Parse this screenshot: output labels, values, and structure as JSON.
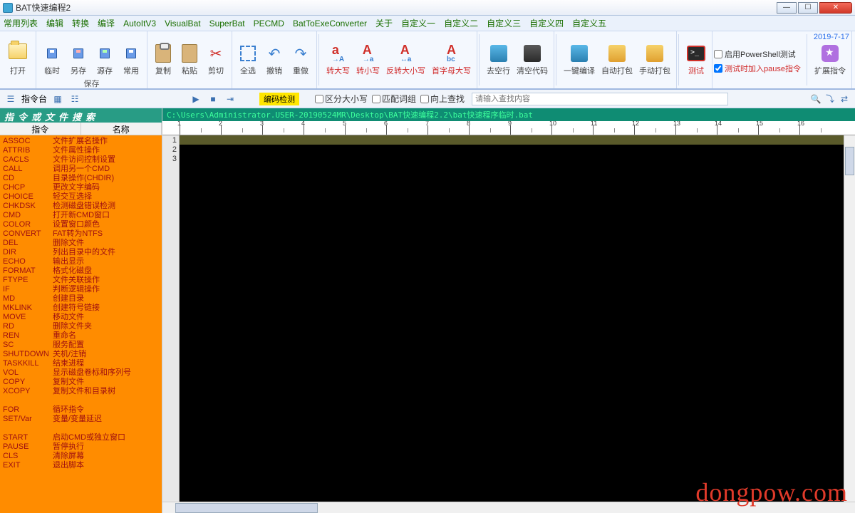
{
  "window": {
    "title": "BAT快速编程2",
    "date": "2019-7-17"
  },
  "menu": [
    "常用列表",
    "编辑",
    "转换",
    "编译",
    "AutoItV3",
    "VisualBat",
    "SuperBat",
    "PECMD",
    "BatToExeConverter",
    "关于",
    "自定义一",
    "自定义二",
    "自定义三",
    "自定义四",
    "自定义五"
  ],
  "ribbon": {
    "open": "打开",
    "save_group_caption": "保存",
    "save_btns": [
      "临时",
      "另存",
      "源存",
      "常用"
    ],
    "copy": "复制",
    "paste": "粘贴",
    "cut": "剪切",
    "selall": "全选",
    "undo": "撤销",
    "redo": "重做",
    "to_upper": "转大写",
    "to_lower": "转小写",
    "flip_case": "反转大小写",
    "first_upper": "首字母大写",
    "trim_blank": "去空行",
    "clear_code": "清空代码",
    "compile": "一键编译",
    "autopack": "自动打包",
    "manualpack": "手动打包",
    "test": "测试",
    "opt_powershell": "启用PowerShell测试",
    "opt_pause": "测试时加入pause指令",
    "ext_cmd": "扩展指令"
  },
  "toolbar2": {
    "panel_label": "指令台",
    "encode_check": "编码检测",
    "chk_case": "区分大小写",
    "chk_word": "匹配词组",
    "chk_up": "向上查找",
    "search_ph": "请输入查找内容"
  },
  "leftpane": {
    "header": "指令或文件搜索",
    "col1": "指令",
    "col2": "名称"
  },
  "commands": [
    {
      "c": "ASSOC",
      "n": "文件扩展名操作"
    },
    {
      "c": "ATTRIB",
      "n": "文件属性操作"
    },
    {
      "c": "CACLS",
      "n": "文件访问控制设置"
    },
    {
      "c": "CALL",
      "n": "调用另一个CMD"
    },
    {
      "c": "CD",
      "n": "目录操作(CHDIR)"
    },
    {
      "c": "CHCP",
      "n": "更改文字编码"
    },
    {
      "c": "CHOICE",
      "n": "轻交互选择"
    },
    {
      "c": "CHKDSK",
      "n": "检测磁盘错误检测"
    },
    {
      "c": "CMD",
      "n": "打开新CMD窗口"
    },
    {
      "c": "COLOR",
      "n": "设置窗口颜色"
    },
    {
      "c": "CONVERT",
      "n": "FAT转为NTFS"
    },
    {
      "c": "DEL",
      "n": "删除文件"
    },
    {
      "c": "DIR",
      "n": "列出目录中的文件"
    },
    {
      "c": "ECHO",
      "n": "输出显示"
    },
    {
      "c": "FORMAT",
      "n": "格式化磁盘"
    },
    {
      "c": "FTYPE",
      "n": "文件关联操作"
    },
    {
      "c": "IF",
      "n": "判断逻辑操作"
    },
    {
      "c": "MD",
      "n": "创建目录"
    },
    {
      "c": "MKLINK",
      "n": "创建符号链接"
    },
    {
      "c": "MOVE",
      "n": "移动文件"
    },
    {
      "c": "RD",
      "n": "删除文件夹"
    },
    {
      "c": "REN",
      "n": "重命名"
    },
    {
      "c": "SC",
      "n": "服务配置"
    },
    {
      "c": "SHUTDOWN",
      "n": "关机/注销"
    },
    {
      "c": "TASKKILL",
      "n": "结束进程"
    },
    {
      "c": "VOL",
      "n": "显示磁盘卷标和序列号"
    },
    {
      "c": "COPY",
      "n": "复制文件"
    },
    {
      "c": "XCOPY",
      "n": "复制文件和目录树"
    }
  ],
  "commands2": [
    {
      "c": "FOR",
      "n": "循环指令"
    },
    {
      "c": "SET/Var",
      "n": "变量/变量延迟"
    }
  ],
  "commands3": [
    {
      "c": "START",
      "n": "启动CMD或独立窗口"
    },
    {
      "c": "PAUSE",
      "n": "暂停执行"
    },
    {
      "c": "CLS",
      "n": "清除屏幕"
    },
    {
      "c": "EXIT",
      "n": "退出脚本"
    }
  ],
  "editor": {
    "path": "C:\\Users\\Administrator.USER-20190524MR\\Desktop\\BAT快速编程2.2\\bat快速程序临时.bat",
    "lines": [
      1,
      2,
      3
    ],
    "ruler_max": 16
  },
  "watermark": "dongpow.com"
}
